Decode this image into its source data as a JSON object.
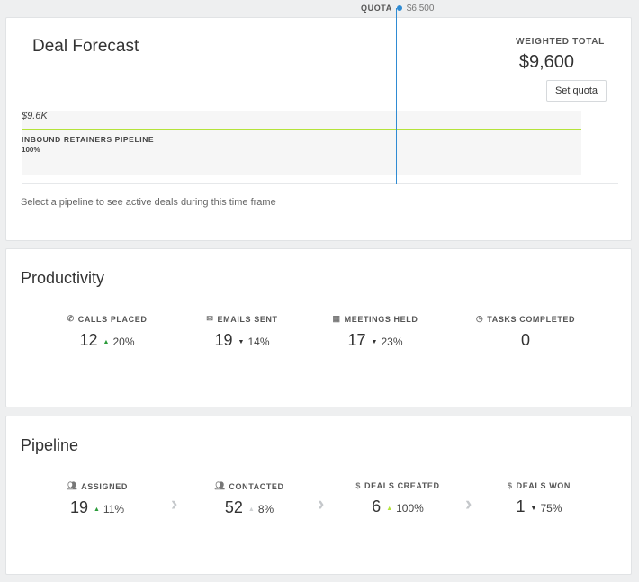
{
  "quota": {
    "label": "QUOTA",
    "value": "$6,500"
  },
  "forecast": {
    "title": "Deal Forecast",
    "weighted_total_label": "WEIGHTED TOTAL",
    "weighted_total_value": "$9,600",
    "set_quota_label": "Set quota",
    "pipeline_amount": "$9.6K",
    "pipeline_name": "INBOUND RETAINERS PIPELINE",
    "pipeline_pct": "100%",
    "hint": "Select a pipeline to see active deals during this time frame"
  },
  "productivity": {
    "title": "Productivity",
    "metrics": [
      {
        "label": "CALLS PLACED",
        "icon": "phone-icon",
        "value": "12",
        "trend": "up",
        "change": "20%"
      },
      {
        "label": "EMAILS SENT",
        "icon": "envelope-icon",
        "value": "19",
        "trend": "down",
        "change": "14%"
      },
      {
        "label": "MEETINGS HELD",
        "icon": "calendar-icon",
        "value": "17",
        "trend": "down",
        "change": "23%"
      },
      {
        "label": "TASKS COMPLETED",
        "icon": "clock-icon",
        "value": "0",
        "trend": "",
        "change": ""
      }
    ]
  },
  "pipeline": {
    "title": "Pipeline",
    "metrics": [
      {
        "label": "ASSIGNED",
        "icon": "people-icon",
        "value": "19",
        "trend": "up",
        "change": "11%"
      },
      {
        "label": "CONTACTED",
        "icon": "people-icon",
        "value": "52",
        "trend": "up-gray",
        "change": "8%"
      },
      {
        "label": "DEALS CREATED",
        "icon": "dollar-icon",
        "value": "6",
        "trend": "up-light",
        "change": "100%"
      },
      {
        "label": "DEALS WON",
        "icon": "dollar-icon",
        "value": "1",
        "trend": "down",
        "change": "75%"
      }
    ]
  },
  "colors": {
    "quota_line": "#2f8bd3",
    "pipeline_line": "#b4e33a",
    "trend_up": "#2c9c3b"
  }
}
